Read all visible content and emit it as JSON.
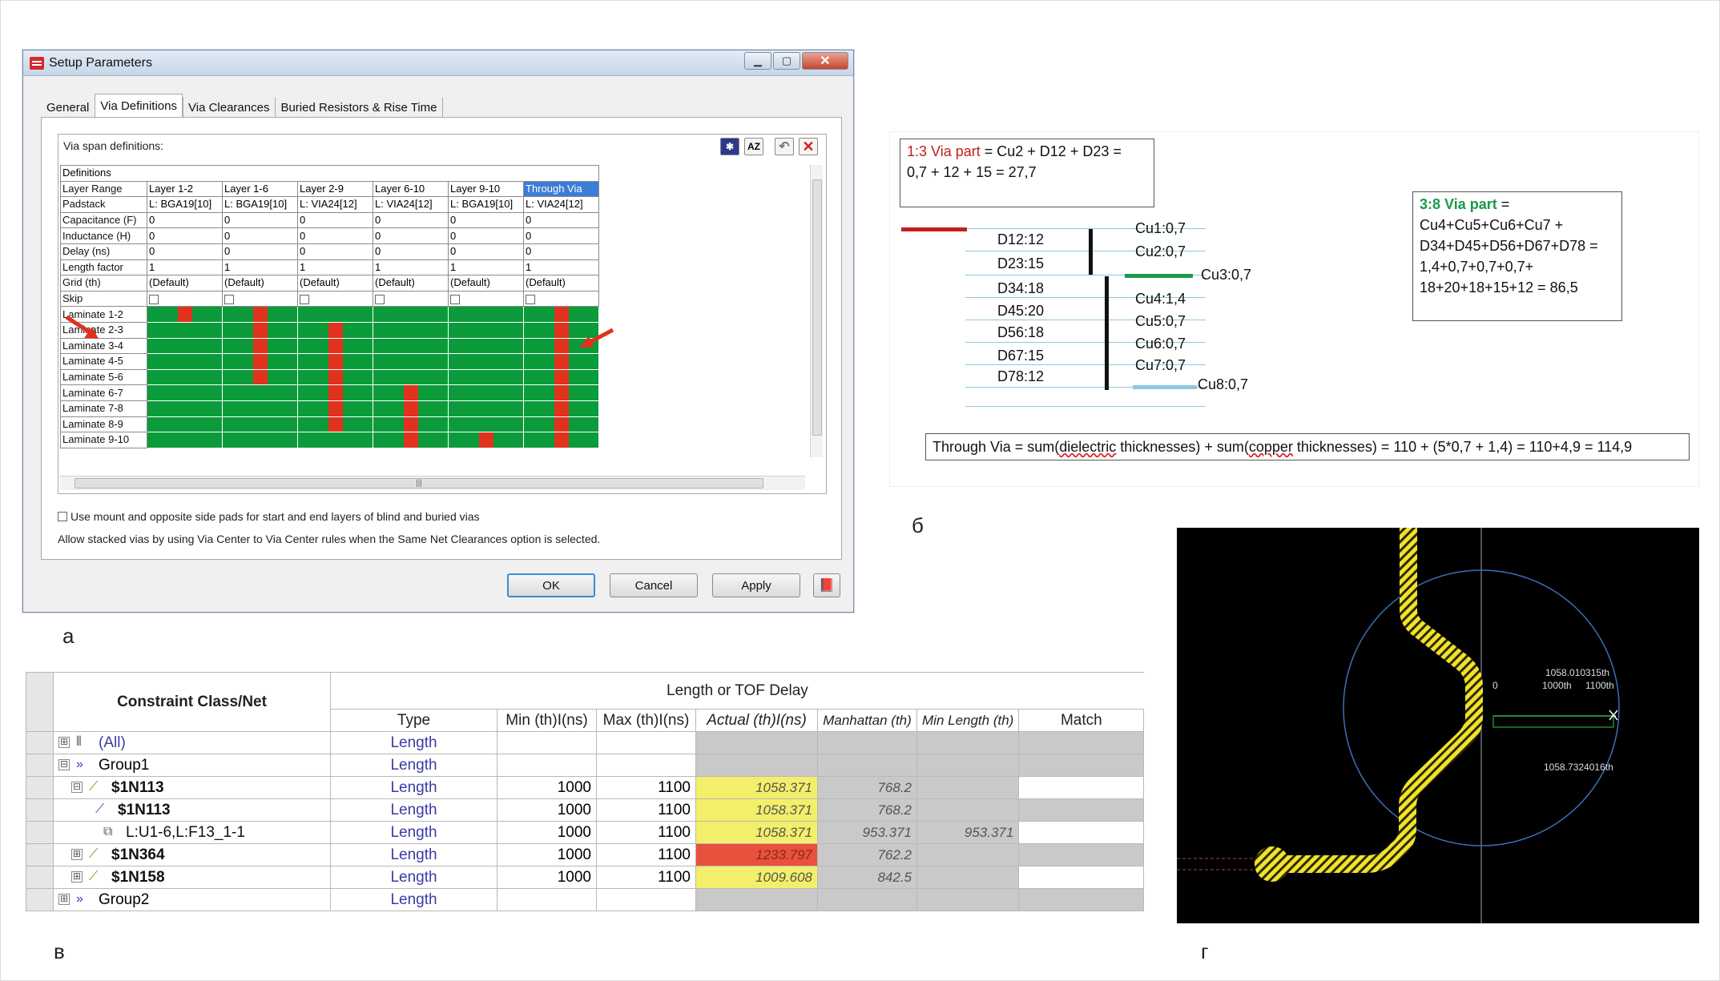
{
  "captions": {
    "a": "а",
    "b": "б",
    "v": "в",
    "g": "г"
  },
  "dialog": {
    "title": "Setup Parameters",
    "tabs": [
      "General",
      "Via Definitions",
      "Via Clearances",
      "Buried Resistors & Rise Time"
    ],
    "frame_label": "Via span definitions:",
    "definitions_label": "Definitions",
    "row_labels": [
      "Layer Range",
      "Padstack",
      "Capacitance (F)",
      "Inductance (H)",
      "Delay (ns)",
      "Length factor",
      "Grid (th)",
      "Skip"
    ],
    "columns": [
      {
        "range": "Layer 1-2",
        "padstack": "L: BGA19[10]",
        "cap": "0",
        "ind": "0",
        "delay": "0",
        "lf": "1",
        "grid": "(Default)"
      },
      {
        "range": "Layer 1-6",
        "padstack": "L: BGA19[10]",
        "cap": "0",
        "ind": "0",
        "delay": "0",
        "lf": "1",
        "grid": "(Default)"
      },
      {
        "range": "Layer 2-9",
        "padstack": "L: VIA24[12]",
        "cap": "0",
        "ind": "0",
        "delay": "0",
        "lf": "1",
        "grid": "(Default)"
      },
      {
        "range": "Layer 6-10",
        "padstack": "L: VIA24[12]",
        "cap": "0",
        "ind": "0",
        "delay": "0",
        "lf": "1",
        "grid": "(Default)"
      },
      {
        "range": "Layer 9-10",
        "padstack": "L: BGA19[10]",
        "cap": "0",
        "ind": "0",
        "delay": "0",
        "lf": "1",
        "grid": "(Default)"
      },
      {
        "range": "Through Via",
        "padstack": "L: VIA24[12]",
        "cap": "0",
        "ind": "0",
        "delay": "0",
        "lf": "1",
        "grid": "(Default)"
      }
    ],
    "laminates": [
      "Laminate 1-2",
      "Laminate 2-3",
      "Laminate 3-4",
      "Laminate 4-5",
      "Laminate 5-6",
      "Laminate 6-7",
      "Laminate 7-8",
      "Laminate 8-9",
      "Laminate 9-10"
    ],
    "option1": "Use mount and opposite side pads for start and end layers of blind and buried vias",
    "option2": "Allow stacked vias by using Via Center to Via Center rules when the Same Net Clearances option is selected.",
    "buttons": {
      "ok": "OK",
      "cancel": "Cancel",
      "apply": "Apply"
    },
    "colors": {
      "span": "#e0321e",
      "laminate": "#0b9b3a",
      "arrow": "#e0321e"
    }
  },
  "stackup": {
    "box1_title": "1:3 Via part",
    "box1_formula": "= Cu2 + D12 + D23 =",
    "box1_result": "0,7 + 12 + 15 = 27,7",
    "box2_title": "3:8 Via part",
    "box2_eq": "=",
    "box2_lines": [
      "Cu4+Cu5+Cu6+Cu7 +",
      "D34+D45+D56+D67+D78 =",
      "1,4+0,7+0,7+0,7+",
      "18+20+18+15+12 = 86,5"
    ],
    "dielectrics": [
      "D12:12",
      "D23:15",
      "D34:18",
      "D45:20",
      "D56:18",
      "D67:15",
      "D78:12"
    ],
    "coppers": [
      "Cu1:0,7",
      "Cu2:0,7",
      "Cu3:0,7",
      "Cu4:1,4",
      "Cu5:0,7",
      "Cu6:0,7",
      "Cu7:0,7",
      "Cu8:0,7"
    ],
    "through_prefix": "Through Via = sum(",
    "through_w1": "dielectric",
    "through_mid": " thicknesses) + sum(",
    "through_w2": "copper",
    "through_suffix": " thicknesses) = 110 + (5*0,7 + 1,4) = 110+4,9 = 114,9",
    "colors": {
      "red": "#c0201c",
      "green": "#1a9a4a"
    }
  },
  "constraints": {
    "col_class": "Constraint Class/Net",
    "group_header": "Length or TOF Delay",
    "cols": [
      "Type",
      "Min (th)I(ns)",
      "Max (th)I(ns)",
      "Actual (th)I(ns)",
      "Manhattan (th)",
      "Min Length (th)",
      "Match"
    ],
    "rows": [
      {
        "exp": "⊞",
        "indent": 0,
        "icon": "all",
        "name": "(All)",
        "type": "Length",
        "min": "",
        "max": "",
        "actual": "",
        "manh": "",
        "minlen": "",
        "kind": "class"
      },
      {
        "exp": "⊟",
        "indent": 0,
        "icon": "group",
        "name": "Group1",
        "type": "Length",
        "min": "",
        "max": "",
        "actual": "",
        "manh": "",
        "minlen": "",
        "kind": "group"
      },
      {
        "exp": "⊟",
        "indent": 1,
        "icon": "net",
        "name": "$1N113",
        "type": "Length",
        "min": "1000",
        "max": "1100",
        "actual": "1058.371",
        "manh": "768.2",
        "minlen": "",
        "kind": "net"
      },
      {
        "exp": "",
        "indent": 2,
        "icon": "net",
        "name": "$1N113",
        "type": "Length",
        "min": "1000",
        "max": "1100",
        "actual": "1058.371",
        "manh": "768.2",
        "minlen": "",
        "kind": "sub"
      },
      {
        "exp": "",
        "indent": 2,
        "icon": "pin",
        "name": "L:U1-6,L:F13_1-1",
        "type": "Length",
        "min": "1000",
        "max": "1100",
        "actual": "1058.371",
        "manh": "953.371",
        "minlen": "953.371",
        "kind": "pin"
      },
      {
        "exp": "⊞",
        "indent": 1,
        "icon": "net",
        "name": "$1N364",
        "type": "Length",
        "min": "1000",
        "max": "1100",
        "actual": "1233.797",
        "manh": "762.2",
        "minlen": "",
        "kind": "net",
        "bad": true
      },
      {
        "exp": "⊞",
        "indent": 1,
        "icon": "net",
        "name": "$1N158",
        "type": "Length",
        "min": "1000",
        "max": "1100",
        "actual": "1009.608",
        "manh": "842.5",
        "minlen": "",
        "kind": "net"
      },
      {
        "exp": "⊞",
        "indent": 0,
        "icon": "group",
        "name": "Group2",
        "type": "Length",
        "min": "",
        "max": "",
        "actual": "",
        "manh": "",
        "minlen": "",
        "kind": "group"
      }
    ]
  },
  "layout_view": {
    "label_top": "1058.010315th",
    "label_1000": "1000th",
    "label_1100": "1100th",
    "label_zero": "0",
    "label_bottom": "1058.7324016th",
    "colors": {
      "trace": "#f2e12e",
      "background": "#000000",
      "circle": "#3b6fb4",
      "ruler": "#1c8a2a"
    }
  }
}
